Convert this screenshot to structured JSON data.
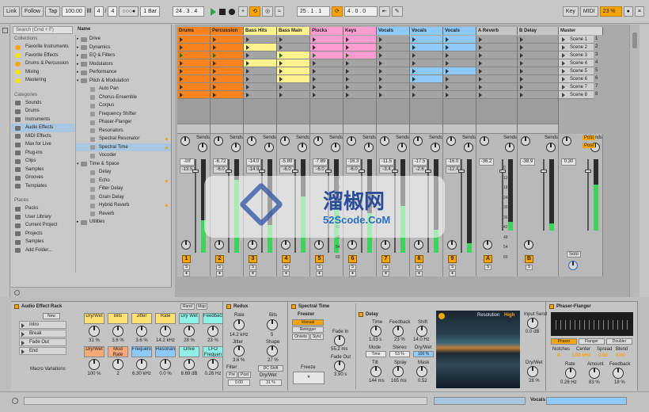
{
  "topbar": {
    "link": "Link",
    "follow": "Follow",
    "tap": "Tap",
    "tempo": "100.00",
    "sig_num": "4",
    "sig_slash": "/",
    "sig_den": "4",
    "metro": "○○○●",
    "quant": "1 Bar",
    "pos1": "24 .  3 .  4",
    "pos2": "25 .  1 .  1",
    "pos3": "4 .  0 .  0",
    "key": "Key",
    "midi": "MIDI",
    "cpu": "23 %"
  },
  "search": {
    "placeholder": "Search (Cmd + F)"
  },
  "browser": {
    "collections_head": "Collections",
    "collections": [
      {
        "label": "Favorite Instruments",
        "color": "#f5a50a"
      },
      {
        "label": "Favorite Effects",
        "color": "#f5e20a"
      },
      {
        "label": "Drums & Percussion",
        "color": "#f5a50a"
      },
      {
        "label": "Mixing",
        "color": "#f5e20a"
      },
      {
        "label": "Mastering",
        "color": "#f5e20a"
      }
    ],
    "categories_head": "Categories",
    "categories": [
      "Sounds",
      "Drums",
      "Instruments",
      "Audio Effects",
      "MIDI Effects",
      "Max for Live",
      "Plug-ins",
      "Clips",
      "Samples",
      "Grooves",
      "Templates"
    ],
    "selected_category": "Audio Effects",
    "places_head": "Places",
    "places": [
      "Packs",
      "User Library",
      "Current Project",
      "Projects",
      "Samples",
      "Add Folder..."
    ],
    "name_head": "Name",
    "tree": [
      {
        "label": "Drive",
        "indent": 0,
        "dot": false
      },
      {
        "label": "Dynamics",
        "indent": 0,
        "dot": false
      },
      {
        "label": "EQ & Filters",
        "indent": 0,
        "dot": false
      },
      {
        "label": "Modulators",
        "indent": 0,
        "dot": false
      },
      {
        "label": "Performance",
        "indent": 0,
        "dot": false
      },
      {
        "label": "Pitch & Modulation",
        "indent": 0,
        "dot": false,
        "open": true
      },
      {
        "label": "Auto Pan",
        "indent": 1,
        "dot": false
      },
      {
        "label": "Chorus-Ensemble",
        "indent": 1,
        "dot": false
      },
      {
        "label": "Corpus",
        "indent": 1,
        "dot": false
      },
      {
        "label": "Frequency Shifter",
        "indent": 1,
        "dot": false
      },
      {
        "label": "Phaser-Flanger",
        "indent": 1,
        "dot": false
      },
      {
        "label": "Resonators",
        "indent": 1,
        "dot": false
      },
      {
        "label": "Spectral Resonator",
        "indent": 1,
        "dot": true
      },
      {
        "label": "Spectral Time",
        "indent": 1,
        "dot": true,
        "sel": true
      },
      {
        "label": "Vocoder",
        "indent": 1,
        "dot": false
      },
      {
        "label": "Time & Space",
        "indent": 0,
        "dot": false,
        "open": true
      },
      {
        "label": "Delay",
        "indent": 1,
        "dot": false
      },
      {
        "label": "Echo",
        "indent": 1,
        "dot": true
      },
      {
        "label": "Filter Delay",
        "indent": 1,
        "dot": false
      },
      {
        "label": "Grain Delay",
        "indent": 1,
        "dot": false
      },
      {
        "label": "Hybrid Reverb",
        "indent": 1,
        "dot": true
      },
      {
        "label": "Reverb",
        "indent": 1,
        "dot": false
      },
      {
        "label": "Utilities",
        "indent": 0,
        "dot": false
      }
    ]
  },
  "tracks": [
    {
      "name": "Drums",
      "color": "#f7831e",
      "clips": [
        1,
        1,
        1,
        1,
        1,
        1,
        1,
        1
      ],
      "num": "1",
      "vol": "-Inf",
      "vol2": "-13.5",
      "meter": 0.35
    },
    {
      "name": "Percussion",
      "color": "#f7831e",
      "clips": [
        1,
        1,
        1,
        1,
        1,
        1,
        1,
        1
      ],
      "num": "2",
      "vol": "-6.72",
      "vol2": "-6.0",
      "meter": 0.78
    },
    {
      "name": "Bass Hits",
      "color": "#fff38f",
      "clips": [
        0,
        1,
        0,
        1,
        0,
        0,
        0,
        0
      ],
      "num": "3",
      "vol": "-14.0",
      "vol2": "-14.9",
      "meter": 0.3
    },
    {
      "name": "Bass Main",
      "color": "#fff38f",
      "clips": [
        0,
        0,
        1,
        1,
        1,
        1,
        0,
        0
      ],
      "num": "4",
      "vol": "-5.89",
      "vol2": "-6.0",
      "meter": 0.6
    },
    {
      "name": "Plucks",
      "color": "#ff9dd0",
      "clips": [
        1,
        1,
        1,
        0,
        0,
        0,
        0,
        0
      ],
      "num": "5",
      "vol": "-7.89",
      "vol2": "-6.0",
      "meter": 0.55
    },
    {
      "name": "Keys",
      "color": "#ff9dd0",
      "clips": [
        1,
        1,
        1,
        0,
        0,
        0,
        0,
        0
      ],
      "num": "6",
      "vol": "-16.3",
      "vol2": "-6.0",
      "meter": 0.42
    },
    {
      "name": "Vocals",
      "color": "#8fc9f7",
      "clips": [
        0,
        0,
        0,
        0,
        0,
        0,
        0,
        0
      ],
      "num": "7",
      "vol": "-11.5",
      "vol2": "-3.4",
      "meter": 0.5
    },
    {
      "name": "Vocals",
      "color": "#8fc9f7",
      "clips": [
        1,
        1,
        0,
        0,
        1,
        1,
        0,
        0
      ],
      "num": "8",
      "vol": "-17.5",
      "vol2": "-2.6",
      "meter": 0.25
    },
    {
      "name": "Vocals",
      "color": "#8fc9f7",
      "clips": [
        1,
        1,
        0,
        0,
        1,
        0,
        0,
        0
      ],
      "num": "9",
      "vol": "-16.0",
      "vol2": "-12.4",
      "meter": 0.1
    },
    {
      "name": "A Reverb",
      "color": "#c4c4c4",
      "clips": [],
      "num": "A",
      "vol": "-36.2",
      "vol2": "",
      "meter": 0.12
    },
    {
      "name": "B Delay",
      "color": "#c4c4c4",
      "clips": [],
      "num": "B",
      "vol": "-38.9",
      "vol2": "",
      "meter": 0.1
    },
    {
      "name": "Master",
      "color": "#d8d8d8",
      "clips": [],
      "num": "",
      "vol": "0.30",
      "vol2": "",
      "meter": 0.65
    }
  ],
  "scenes": [
    "Scene 1",
    "Scene 2",
    "Scene 3",
    "Scene 4",
    "Scene 5",
    "Scene 6",
    "Scene 7",
    "Scene 8"
  ],
  "scene_nums": [
    "1",
    "2",
    "3",
    "4",
    "5",
    "6",
    "7",
    "8"
  ],
  "mixer": {
    "sends": "Sends",
    "post": "Post",
    "solo": "Solo",
    "scale": [
      "6",
      "12",
      "18",
      "24",
      "30",
      "36",
      "42",
      "48",
      "54",
      "60"
    ]
  },
  "rack": {
    "title": "Audio Effect Rack",
    "rand": "Rand",
    "map": "Map",
    "new": "New",
    "chains": [
      "Intro",
      "Break",
      "Fade Out",
      "End"
    ],
    "macro_vars": "Macro Variations",
    "macros": [
      {
        "label": "Dry/Wet",
        "val": "31 %",
        "color": "#ffe173"
      },
      {
        "label": "Bits",
        "val": "3.6 %",
        "color": "#ffe173"
      },
      {
        "label": "Jitter",
        "val": "3.6 %",
        "color": "#ffe173"
      },
      {
        "label": "Rate",
        "val": "14.2 kHz",
        "color": "#ffe173"
      },
      {
        "label": "Dry Wet",
        "val": "28 %",
        "color": "#8ff0e5"
      },
      {
        "label": "Feedback",
        "val": "23 %",
        "color": "#8ff0e5"
      },
      {
        "label": "Dry/Wet",
        "val": "100 %",
        "color": "#f7a978"
      },
      {
        "label": "Mod Rate",
        "val": "2",
        "color": "#f7a978"
      },
      {
        "label": "Frequency",
        "val": "6.30 kHz",
        "color": "#8fc9f7"
      },
      {
        "label": "Resonance",
        "val": "0.0 %",
        "color": "#8fc9f7"
      },
      {
        "label": "Drive",
        "val": "8.69 dB",
        "color": "#8ff0e5"
      },
      {
        "label": "LFO Frequen",
        "val": "0.26 Hz",
        "color": "#8ff0e5"
      }
    ]
  },
  "redux": {
    "title": "Redux",
    "rate": "Rate",
    "rate_val": "14.2 kHz",
    "bits": "Bits",
    "bits_val": "5",
    "jitter": "Jitter",
    "jitter_val": "3.6 %",
    "shape": "Shape",
    "shape_val": "27 %",
    "filter": "Filter",
    "pre": "Pre",
    "post": "Post",
    "filt_val": "0.00",
    "dc": "DC Shift",
    "drywet": "Dry/Wet",
    "dw_val": "31 %"
  },
  "spectral": {
    "title": "Spectral Time",
    "freezer": "Freezer",
    "manual": "Manual",
    "retrigger": "Retrigger",
    "onsets": "Onsets",
    "sync": "Sync",
    "fadein": "Fade In",
    "fadein_val": "55.2 ms",
    "fadeout": "Fade Out",
    "fadeout_val": "3.90 s",
    "freeze": "Freeze",
    "delay": "Delay",
    "time": "Time",
    "time_val": "1.03 s",
    "feedback": "Feedback",
    "fb_val": "23 %",
    "shift": "Shift",
    "shift_val": "14.0 Hz",
    "mode": "Mode",
    "mode_val": "Time",
    "stereo": "Stereo",
    "stereo_val": "53 %",
    "dw": "Dry/Wet",
    "dw_val": "100 %",
    "tilt": "Tilt",
    "tilt_val": "144 ms",
    "spray": "Spray",
    "spray_val": "165 ms",
    "mask": "Mask",
    "mask_val": "0.52",
    "resolution": "Resolution",
    "res_val": "High",
    "input_send": "Input Send",
    "is_val": "0.0 dB",
    "dw2": "Dry/Wet",
    "dw2_val": "28 %"
  },
  "phaser": {
    "title": "Phaser-Flanger",
    "modes": [
      "Phaser",
      "Flanger",
      "Doubler"
    ],
    "notches": "Notches",
    "notches_val": "4",
    "center": "Center",
    "center_val": "1.00 kHz",
    "spread": "Spread",
    "spread_val": "0.50",
    "blend": "Blend",
    "blend_val": "0.00",
    "rate": "Rate",
    "rate_val": "0.26 Hz",
    "amount": "Amount",
    "amount_val": "83 %",
    "feedback": "Feedback",
    "fb_val": "18 %"
  },
  "status": {
    "track": "Vocals"
  },
  "watermark": {
    "title": "溜椒网",
    "url": "52Scode.CoM"
  }
}
